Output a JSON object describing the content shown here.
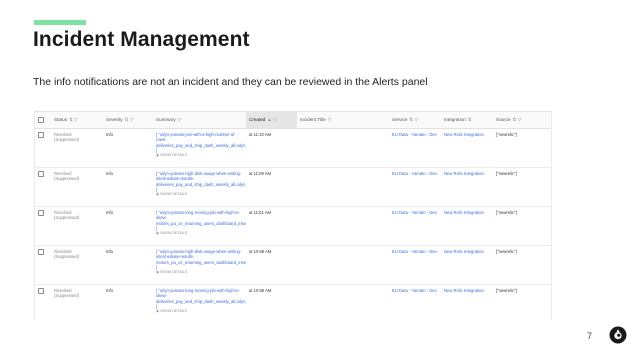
{
  "slide": {
    "title": "Incident Management",
    "subtitle": "The info notifications are not an incident and they can be reviewed in the Alerts panel",
    "page_number": "7",
    "accent_color": "#7ee3a2"
  },
  "table": {
    "columns": {
      "status": "Status",
      "severity": "Severity",
      "summary": "Summary",
      "created": "Created",
      "incident_title": "Incident Title",
      "service": "Service",
      "integration": "Integration",
      "source": "Source"
    },
    "show_details_label": "SHOW DETAILS",
    "rows": [
      {
        "status": "Resolved",
        "status_sub": "(Suppressed)",
        "severity": "Info",
        "summary": "[ \"odyn-yamato-join-with-a-high-number-of-rows-deliveries_pay_and_ship_dash_weekly_all,odyn_deliveries\" ]",
        "created": "at 11:10 AM",
        "incident_title": "",
        "service": "EU Data - Yamato - Dev",
        "integration": "New Relic Integration",
        "source": "[\"newrelic\"]"
      },
      {
        "status": "Resolved",
        "status_sub": "(Suppressed)",
        "severity": "Info",
        "summary": "[ \"odyn-yamato-high-disk-usage-when-writing-intermediate-results-deliveries_pay_and_ship_dash_weekly_all,odyn_deliveries\" ]",
        "created": "at 11:09 AM",
        "incident_title": "",
        "service": "EU Data - Yamato - Dev",
        "integration": "New Relic Integration",
        "source": "[\"newrelic\"]"
      },
      {
        "status": "Resolved",
        "status_sub": "(Suppressed)",
        "severity": "Info",
        "summary": "[ \"odyn-yamato-long-running-job-with-high-io-skew-motors_pa_ce_returning_users_dashboard_insert,odyn_motors_pa\" ]",
        "created": "at 11:01 AM",
        "incident_title": "",
        "service": "EU Data - Yamato - Dev",
        "integration": "New Relic Integration",
        "source": "[\"newrelic\"]"
      },
      {
        "status": "Resolved",
        "status_sub": "(Suppressed)",
        "severity": "Info",
        "summary": "[ \"odyn-yamato-high-disk-usage-when-writing-intermediate-results-motors_pa_ce_returning_users_dashboard_insert,odyn_motors_pa\" ]",
        "created": "at 10:59 AM",
        "incident_title": "",
        "service": "EU Data - Yamato - Dev",
        "integration": "New Relic Integration",
        "source": "[\"newrelic\"]"
      },
      {
        "status": "Resolved",
        "status_sub": "(Suppressed)",
        "severity": "Info",
        "summary": "[ \"odyn-yamato-long-running-job-with-high-io-skew-deliveries_pay_and_ship_dash_weekly_all,odyn_deliveries\" ]",
        "created": "at 10:59 AM",
        "incident_title": "",
        "service": "EU Data - Yamato - Dev",
        "integration": "New Relic Integration",
        "source": "[\"newrelic\"]"
      }
    ]
  }
}
